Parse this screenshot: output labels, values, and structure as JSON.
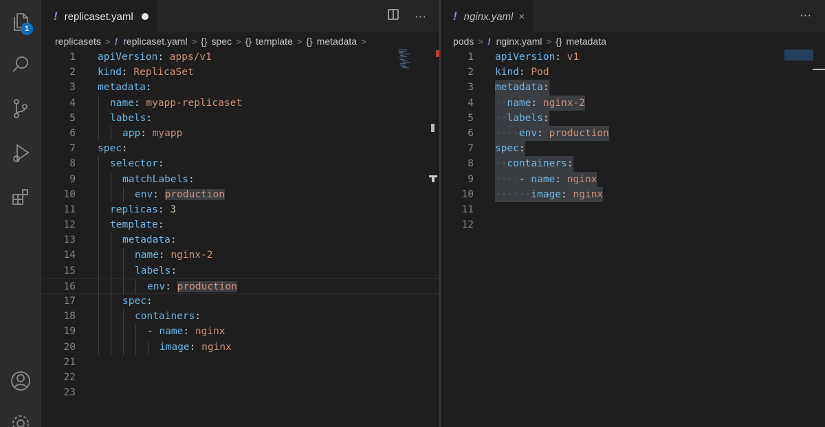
{
  "activity_bar": {
    "explorer_badge": "1",
    "icons": [
      "files-icon",
      "search-icon",
      "source-control-icon",
      "run-debug-icon",
      "extensions-icon",
      "account-icon",
      "settings-gear-icon"
    ]
  },
  "left_editor": {
    "tab": {
      "bang": "!",
      "filename": "replicaset.yaml",
      "modified": true
    },
    "breadcrumb": [
      "replicasets",
      "replicaset.yaml",
      "spec",
      "template",
      "metadata"
    ],
    "line_numbers": [
      "1",
      "2",
      "3",
      "4",
      "5",
      "6",
      "7",
      "8",
      "9",
      "10",
      "11",
      "12",
      "13",
      "14",
      "15",
      "16",
      "17",
      "18",
      "19",
      "20",
      "21",
      "22",
      "23"
    ],
    "lines": [
      {
        "key": "apiVersion",
        "val": "apps/v1",
        "indent": 0
      },
      {
        "key": "kind",
        "val": "ReplicaSet",
        "indent": 0
      },
      {
        "key": "metadata",
        "val": "",
        "indent": 0
      },
      {
        "key": "name",
        "val": "myapp-replicaset",
        "indent": 1
      },
      {
        "key": "labels",
        "val": "",
        "indent": 1
      },
      {
        "key": "app",
        "val": "myapp",
        "indent": 2
      },
      {
        "key": "spec",
        "val": "",
        "indent": 0
      },
      {
        "key": "selector",
        "val": "",
        "indent": 1
      },
      {
        "key": "matchLabels",
        "val": "",
        "indent": 2
      },
      {
        "key": "env",
        "val": "production",
        "indent": 3
      },
      {
        "key": "replicas",
        "val": "3",
        "indent": 1
      },
      {
        "key": "template",
        "val": "",
        "indent": 1
      },
      {
        "key": "metadata",
        "val": "",
        "indent": 2
      },
      {
        "key": "name",
        "val": "nginx-2",
        "indent": 3
      },
      {
        "key": "labels",
        "val": "",
        "indent": 3
      },
      {
        "key": "env",
        "val": "production",
        "indent": 4
      },
      {
        "key": "spec",
        "val": "",
        "indent": 2
      },
      {
        "key": "containers",
        "val": "",
        "indent": 3
      },
      {
        "key": "name",
        "val": "nginx",
        "indent": 4,
        "dash": true
      },
      {
        "key": "image",
        "val": "nginx",
        "indent": 5
      },
      {
        "key": "",
        "val": "",
        "indent": 0
      },
      {
        "key": "",
        "val": "",
        "indent": 0
      },
      {
        "key": "",
        "val": "",
        "indent": 0
      }
    ]
  },
  "right_editor": {
    "tab": {
      "bang": "!",
      "filename": "nginx.yaml",
      "close": "×"
    },
    "breadcrumb": [
      "pods",
      "nginx.yaml",
      "metadata"
    ],
    "line_numbers": [
      "1",
      "2",
      "3",
      "4",
      "5",
      "6",
      "7",
      "8",
      "9",
      "10",
      "11",
      "12"
    ],
    "lines": [
      {
        "key": "apiVersion",
        "val": "v1",
        "indent": 0
      },
      {
        "key": "kind",
        "val": "Pod",
        "indent": 0
      },
      {
        "key": "metadata",
        "val": "",
        "indent": 0
      },
      {
        "key": "name",
        "val": "nginx-2",
        "indent": 1
      },
      {
        "key": "labels",
        "val": "",
        "indent": 1
      },
      {
        "key": "env",
        "val": "production",
        "indent": 2
      },
      {
        "key": "spec",
        "val": "",
        "indent": 0
      },
      {
        "key": "containers",
        "val": "",
        "indent": 1
      },
      {
        "key": "name",
        "val": "nginx",
        "indent": 2,
        "dash": true
      },
      {
        "key": "image",
        "val": "nginx",
        "indent": 3
      },
      {
        "key": "",
        "val": "",
        "indent": 0
      },
      {
        "key": "",
        "val": "",
        "indent": 0
      }
    ]
  },
  "colors": {
    "key": "#6cb6e7",
    "string": "#ce9178",
    "yaml_bang": "#b180d7",
    "badge": "#0e70c0"
  }
}
